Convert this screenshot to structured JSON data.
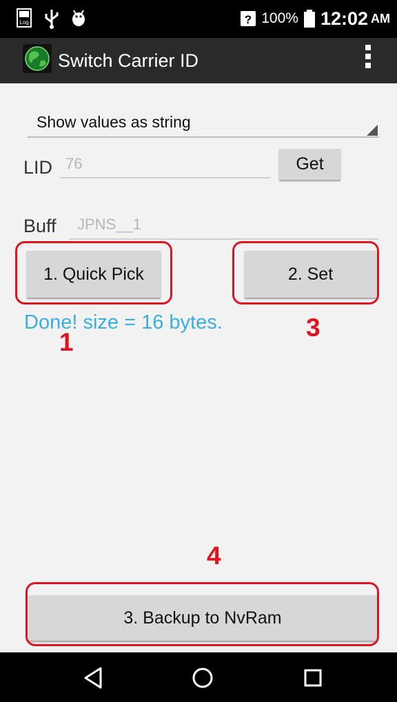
{
  "status_bar": {
    "icons": [
      "log-icon",
      "usb-icon",
      "android-debug-icon"
    ],
    "battery_percent": "100%",
    "time": "12:02",
    "ampm": "AM",
    "signal_badge": "?"
  },
  "app_bar": {
    "title": "Switch Carrier ID"
  },
  "spinner": {
    "selected": "Show values as string"
  },
  "lid": {
    "label": "LID",
    "value": "76"
  },
  "get_button": {
    "label": "Get"
  },
  "buff": {
    "label": "Buff",
    "value": "JPNS__1"
  },
  "quick_pick_button": {
    "label": "1. Quick Pick"
  },
  "set_button": {
    "label": "2. Set"
  },
  "status_message": "Done! size = 16 bytes.",
  "backup_button": {
    "label": "3. Backup to NvRam"
  },
  "annotations": {
    "a1": "1",
    "a3": "3",
    "a4": "4",
    "color": "#e0141e"
  },
  "colors": {
    "status_text": "#3aaee0",
    "app_bar": "#2a2a2a",
    "background": "#f2f2f2"
  },
  "nav": {
    "icons": [
      "back-icon",
      "home-icon",
      "recents-icon"
    ]
  }
}
